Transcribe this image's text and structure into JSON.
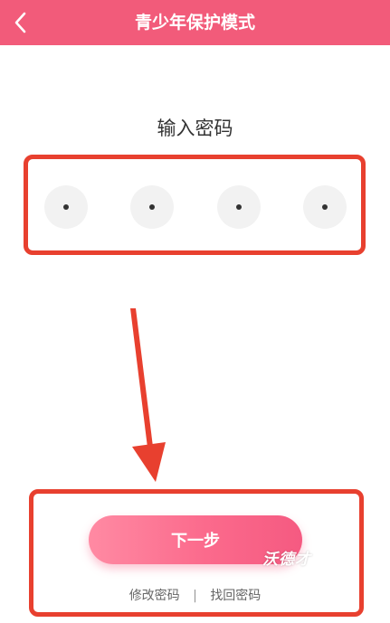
{
  "header": {
    "title": "青少年保护模式",
    "back_icon": "chevron-left-icon",
    "background_color": "#f25b7a"
  },
  "password": {
    "prompt": "输入密码",
    "digits_entered": 4,
    "digits_total": 4
  },
  "actions": {
    "next_label": "下一步",
    "modify_password_label": "修改密码",
    "separator": "|",
    "recover_password_label": "找回密码"
  },
  "overlay": {
    "watermark_text": "沃德才",
    "annotation_color": "#e8402f"
  }
}
